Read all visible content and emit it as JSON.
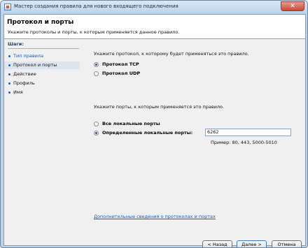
{
  "window": {
    "title": "Мастер создания правила для нового входящего подключения",
    "close_glyph": "✕"
  },
  "header": {
    "title": "Протокол и порты",
    "subtitle": "Укажите протоколы и порты, к которым применяется данное правило."
  },
  "steps": {
    "heading": "Шаги:",
    "items": [
      {
        "label": "Тип правила"
      },
      {
        "label": "Протокол и порты"
      },
      {
        "label": "Действие"
      },
      {
        "label": "Профиль"
      },
      {
        "label": "Имя"
      }
    ]
  },
  "protocol": {
    "prompt": "Укажите протокол, к которому будет применяться это правило.",
    "options": [
      {
        "label": "Протокол TCP",
        "checked": true
      },
      {
        "label": "Протокол UDP",
        "checked": false
      }
    ]
  },
  "ports": {
    "prompt": "Укажите порты, к которым применяется это правило.",
    "options": [
      {
        "label": "Все локальные порты",
        "checked": false
      },
      {
        "label": "Определенные локальные порты:",
        "checked": true
      }
    ],
    "value": "6262",
    "example": "Пример: 80, 443, 5000-5010"
  },
  "more_info_link": "Дополнительные сведения о протоколах и портах",
  "buttons": {
    "back": "< Назад",
    "next": "Далее >",
    "cancel": "Отмена"
  }
}
